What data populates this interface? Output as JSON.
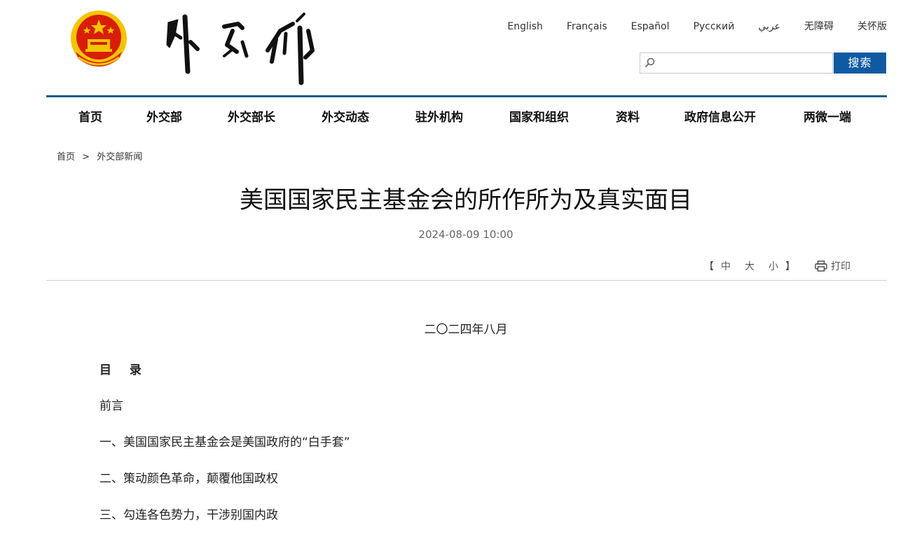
{
  "header": {
    "languages": [
      "English",
      "Français",
      "Español",
      "Русский",
      "عربي",
      "无障碍",
      "关怀版"
    ],
    "search": {
      "placeholder": "",
      "button": "搜索"
    },
    "colors": {
      "brand_blue": "#0f5aa3",
      "nav_border": "#1e5a8c",
      "emblem_red": "#d81e06",
      "emblem_gold": "#f5c400"
    }
  },
  "nav": {
    "items": [
      "首页",
      "外交部",
      "外交部长",
      "外交动态",
      "驻外机构",
      "国家和组织",
      "资料",
      "政府信息公开",
      "两微一端"
    ]
  },
  "breadcrumb": {
    "home": "首页",
    "separator": ">",
    "current": "外交部新闻"
  },
  "article": {
    "title": "美国国家民主基金会的所作所为及真实面目",
    "date": "2024-08-09 10:00",
    "font_controls": {
      "open": "【",
      "large": "中",
      "medium": "大",
      "small": "小",
      "close": "】"
    },
    "print": "打印",
    "date_line": "二〇二四年八月",
    "toc_title": "目 录",
    "toc": [
      "前言",
      "一、美国国家民主基金会是美国政府的“白手套”",
      "二、策动颜色革命，颠覆他国政权",
      "三、勾连各色势力，干涉别国内政"
    ]
  }
}
